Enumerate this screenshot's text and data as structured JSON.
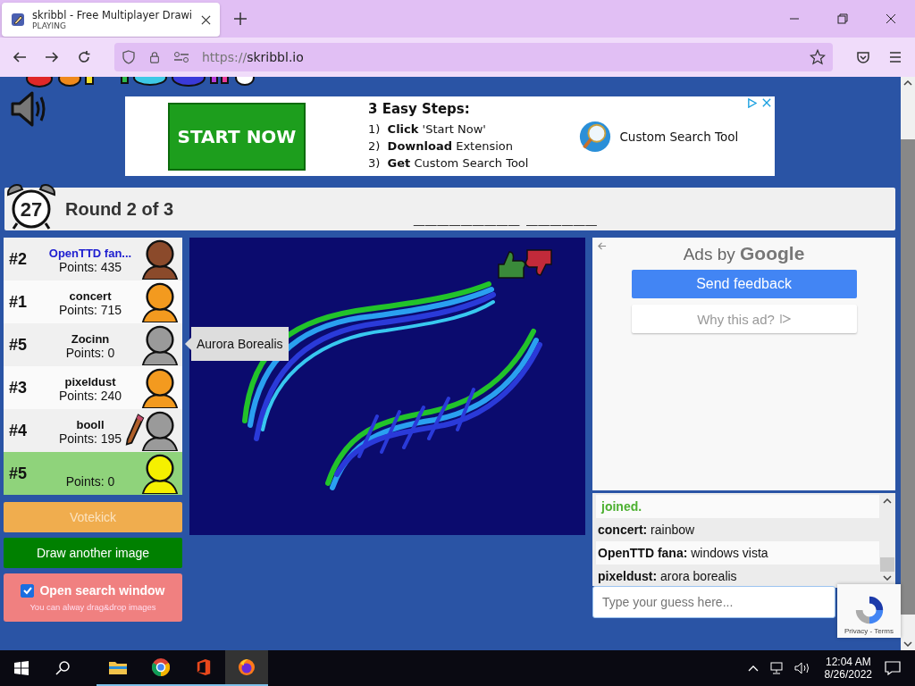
{
  "browser": {
    "tab": {
      "title": "skribbl - Free Multiplayer Drawi",
      "subtitle": "PLAYING",
      "selected": true
    },
    "url_scheme": "https://",
    "url_host": "skribbl.io"
  },
  "ad_banner": {
    "button": "START NOW",
    "heading": "3 Easy Steps:",
    "steps": [
      "1)  **Click** 'Start Now'",
      "2)  **Download** Extension",
      "3)  **Get** Custom Search Tool"
    ],
    "product": "Custom Search Tool"
  },
  "game_bar": {
    "timer": "27",
    "round": "Round 2 of 3",
    "hint": "_________ ______"
  },
  "players": [
    {
      "rank": "#2",
      "name": "OpenTTD fan...",
      "points": "Points: 435",
      "color": "#8b4a2b",
      "highlighted": true,
      "guessed": false,
      "drawing": false
    },
    {
      "rank": "#1",
      "name": "concert",
      "points": "Points: 715",
      "color": "#f39a1f",
      "highlighted": false,
      "guessed": false,
      "drawing": false
    },
    {
      "rank": "#5",
      "name": "Zocinn",
      "points": "Points: 0",
      "color": "#9a9a9a",
      "highlighted": false,
      "guessed": false,
      "drawing": false
    },
    {
      "rank": "#3",
      "name": "pixeldust",
      "points": "Points: 240",
      "color": "#f39a1f",
      "highlighted": false,
      "guessed": false,
      "drawing": false
    },
    {
      "rank": "#4",
      "name": "booll",
      "points": "Points: 195",
      "color": "#9a9a9a",
      "highlighted": false,
      "guessed": false,
      "drawing": true
    },
    {
      "rank": "#5",
      "points": "Points: 0",
      "color": "#f5f000",
      "guessed": true,
      "drawing": false
    }
  ],
  "tooltip": "Aurora Borealis",
  "buttons": {
    "votekick": "Votekick",
    "draw_another": "Draw another image"
  },
  "search_option": {
    "label": "Open search window",
    "checked": true,
    "hint": "You can alway drag&drop images"
  },
  "ad_panel": {
    "title_prefix": "Ads by",
    "title_brand": "Google",
    "feedback": "Send feedback",
    "why": "Why this ad?"
  },
  "chat": [
    {
      "kind": "system",
      "text": "joined."
    },
    {
      "kind": "message",
      "name": "concert:",
      "text": "rainbow"
    },
    {
      "kind": "message",
      "name": "OpenTTD fana:",
      "text": "windows vista"
    },
    {
      "kind": "message",
      "name": "pixeldust:",
      "text": "arora borealis"
    }
  ],
  "guess_input": {
    "placeholder": "Type your guess here..."
  },
  "recaptcha": {
    "privacy": "Privacy",
    "separator": "-",
    "terms": "Terms"
  },
  "taskbar": {
    "time": "12:04 AM",
    "date": "8/26/2022"
  }
}
